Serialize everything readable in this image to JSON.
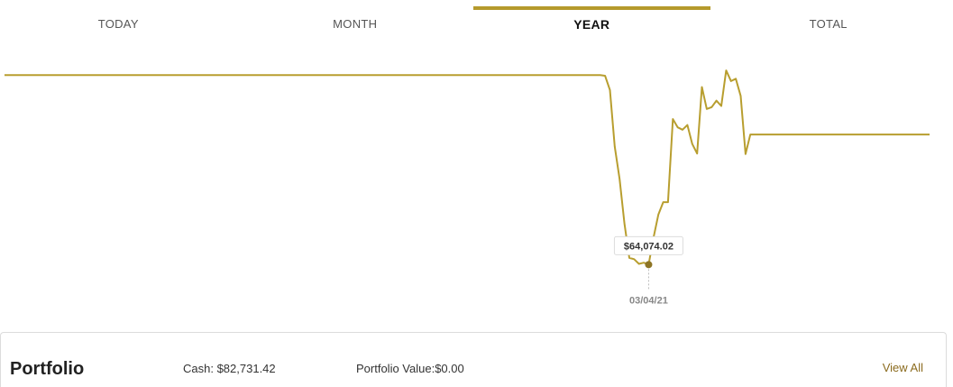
{
  "tabs": [
    {
      "label": "TODAY",
      "active": false
    },
    {
      "label": "MONTH",
      "active": false
    },
    {
      "label": "YEAR",
      "active": true
    },
    {
      "label": "TOTAL",
      "active": false
    }
  ],
  "colors": {
    "accent": "#b59a2c",
    "line": "#b89e2f",
    "link": "#8b6b1e"
  },
  "chart_data": {
    "type": "line",
    "xlabel": "",
    "ylabel": "",
    "grid": false,
    "legend": "none",
    "ylim": [
      62000,
      100000
    ],
    "series": [
      {
        "values": [
          96000,
          96000,
          96000,
          96000,
          96000,
          96000,
          96000,
          96000,
          96000,
          96000,
          96000,
          96000,
          96000,
          96000,
          96000,
          96000,
          96000,
          96000,
          96000,
          96000,
          96000,
          96000,
          96000,
          96000,
          96000,
          96000,
          96000,
          96000,
          96000,
          96000,
          96000,
          96000,
          96000,
          96000,
          96000,
          96000,
          96000,
          96000,
          96000,
          96000,
          96000,
          96000,
          96000,
          96000,
          96000,
          96000,
          96000,
          96000,
          96000,
          96000,
          96000,
          96000,
          96000,
          96000,
          96000,
          96000,
          96000,
          96000,
          96000,
          96000,
          96000,
          96000,
          96000,
          96000,
          96000,
          96000,
          96000,
          96000,
          96000,
          96000,
          96000,
          96000,
          96000,
          96000,
          96000,
          96000,
          96000,
          96000,
          96000,
          96000,
          96000,
          96000,
          96000,
          96000,
          96000,
          96000,
          96000,
          96000,
          96000,
          96000,
          96000,
          96000,
          96000,
          96000,
          96000,
          96000,
          96000,
          96000,
          96000,
          96000,
          96000,
          96000,
          96000,
          96000,
          96000,
          96000,
          96000,
          96000,
          96000,
          96000,
          96000,
          96000,
          96000,
          96000,
          96000,
          96000,
          96000,
          96000,
          96000,
          96000,
          96000,
          96000,
          96000,
          96000,
          95900,
          93500,
          84000,
          78500,
          71000,
          65200,
          65000,
          64200,
          64400,
          64074.02,
          68600,
          72500,
          74600,
          74600,
          88600,
          87200,
          86800,
          87600,
          84400,
          82800,
          94000,
          90300,
          90600,
          91700,
          90800,
          96800,
          95000,
          95400,
          92500,
          82700,
          86000,
          86000,
          86000,
          86000,
          86000,
          86000,
          86000,
          86000,
          86000,
          86000,
          86000,
          86000,
          86000,
          86000,
          86000,
          86000,
          86000,
          86000,
          86000,
          86000,
          86000,
          86000,
          86000,
          86000,
          86000,
          86000,
          86000,
          86000,
          86000,
          86000,
          86000,
          86000,
          86000,
          86000,
          86000,
          86000,
          86000,
          86000
        ]
      }
    ],
    "tooltip": {
      "index": 133,
      "value_label": "$64,074.02",
      "date_label": "03/04/21"
    }
  },
  "portfolio": {
    "title": "Portfolio",
    "cash_text": "Cash: $82,731.42",
    "portfolio_value_text": "Portfolio Value:$0.00",
    "view_all_label": "View All"
  }
}
